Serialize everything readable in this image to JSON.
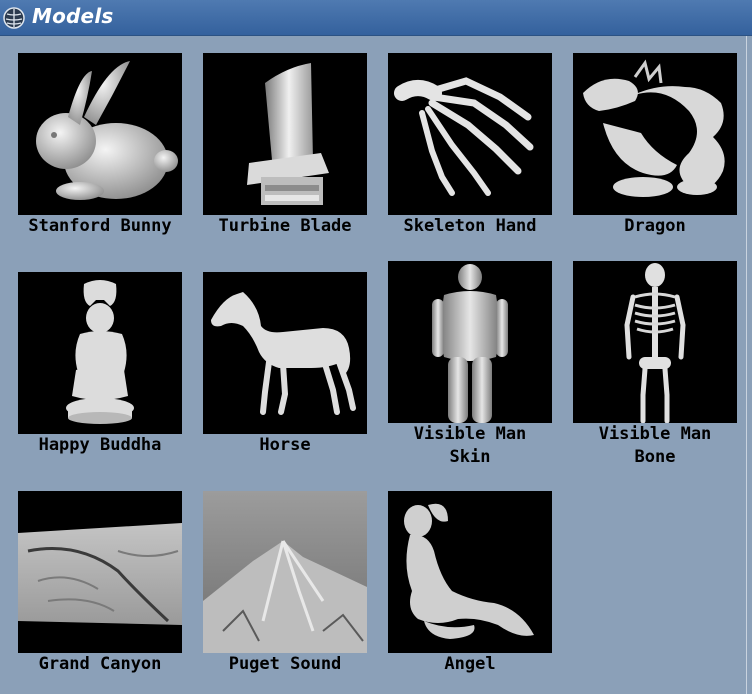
{
  "window": {
    "title": "Models",
    "icon": "brain-icon"
  },
  "models": [
    {
      "id": "stanford-bunny",
      "label_lines": [
        "Stanford Bunny"
      ],
      "thumbnail": "bunny-thumbnail"
    },
    {
      "id": "turbine-blade",
      "label_lines": [
        "Turbine Blade"
      ],
      "thumbnail": "turbine-blade-thumbnail"
    },
    {
      "id": "skeleton-hand",
      "label_lines": [
        "Skeleton Hand"
      ],
      "thumbnail": "skeleton-hand-thumbnail"
    },
    {
      "id": "dragon",
      "label_lines": [
        "Dragon"
      ],
      "thumbnail": "dragon-thumbnail"
    },
    {
      "id": "happy-buddha",
      "label_lines": [
        "Happy Buddha"
      ],
      "thumbnail": "buddha-thumbnail"
    },
    {
      "id": "horse",
      "label_lines": [
        "Horse"
      ],
      "thumbnail": "horse-thumbnail"
    },
    {
      "id": "visible-man-skin",
      "label_lines": [
        "Visible Man",
        "Skin"
      ],
      "thumbnail": "visible-man-skin-thumbnail"
    },
    {
      "id": "visible-man-bone",
      "label_lines": [
        "Visible Man",
        "Bone"
      ],
      "thumbnail": "visible-man-bone-thumbnail"
    },
    {
      "id": "grand-canyon",
      "label_lines": [
        "Grand Canyon"
      ],
      "thumbnail": "grand-canyon-thumbnail"
    },
    {
      "id": "puget-sound",
      "label_lines": [
        "Puget Sound"
      ],
      "thumbnail": "puget-sound-thumbnail"
    },
    {
      "id": "angel",
      "label_lines": [
        "Angel"
      ],
      "thumbnail": "angel-thumbnail"
    }
  ],
  "colors": {
    "background": "#8ba0b8",
    "titlebar": "#3a68a4",
    "thumb_bg": "#000000",
    "model_fill": "#d6d6d6"
  }
}
